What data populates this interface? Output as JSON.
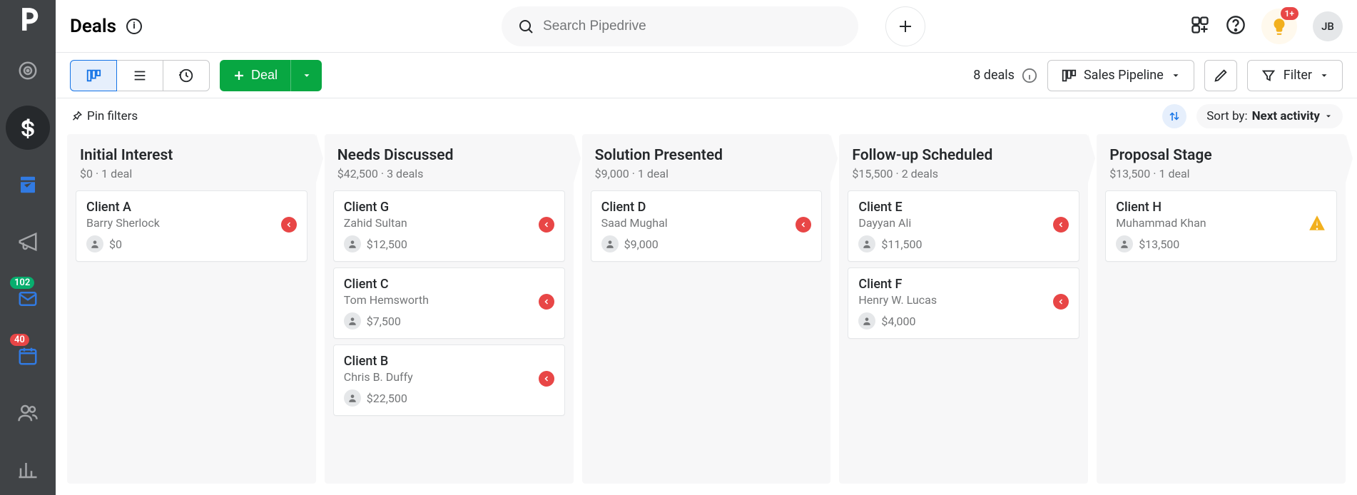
{
  "header": {
    "title": "Deals",
    "search_placeholder": "Search Pipedrive",
    "assist_count": "1+",
    "user_initials": "JB"
  },
  "toolbar": {
    "deal_label": "Deal",
    "deal_count_label": "8 deals",
    "pipeline_label": "Sales Pipeline",
    "filter_label": "Filter"
  },
  "subbar": {
    "pin_filters_label": "Pin filters",
    "sort_prefix": "Sort by:",
    "sort_value": "Next activity"
  },
  "sidebar_badges": {
    "inbox": "102",
    "activities": "40"
  },
  "columns": [
    {
      "title": "Initial Interest",
      "total": "$0",
      "count_label": "1 deal",
      "cards": [
        {
          "name": "Client A",
          "owner": "Barry Sherlock",
          "amount": "$0",
          "status": "overdue"
        }
      ]
    },
    {
      "title": "Needs Discussed",
      "total": "$42,500",
      "count_label": "3 deals",
      "cards": [
        {
          "name": "Client G",
          "owner": "Zahid Sultan",
          "amount": "$12,500",
          "status": "overdue"
        },
        {
          "name": "Client C",
          "owner": "Tom Hemsworth",
          "amount": "$7,500",
          "status": "overdue"
        },
        {
          "name": "Client B",
          "owner": "Chris B. Duffy",
          "amount": "$22,500",
          "status": "overdue"
        }
      ]
    },
    {
      "title": "Solution Presented",
      "total": "$9,000",
      "count_label": "1 deal",
      "cards": [
        {
          "name": "Client D",
          "owner": "Saad Mughal",
          "amount": "$9,000",
          "status": "overdue"
        }
      ]
    },
    {
      "title": "Follow-up Scheduled",
      "total": "$15,500",
      "count_label": "2 deals",
      "cards": [
        {
          "name": "Client E",
          "owner": "Dayyan Ali",
          "amount": "$11,500",
          "status": "overdue"
        },
        {
          "name": "Client F",
          "owner": "Henry W. Lucas",
          "amount": "$4,000",
          "status": "overdue"
        }
      ]
    },
    {
      "title": "Proposal Stage",
      "total": "$13,500",
      "count_label": "1 deal",
      "cards": [
        {
          "name": "Client H",
          "owner": "Muhammad Khan",
          "amount": "$13,500",
          "status": "warning"
        }
      ]
    }
  ]
}
